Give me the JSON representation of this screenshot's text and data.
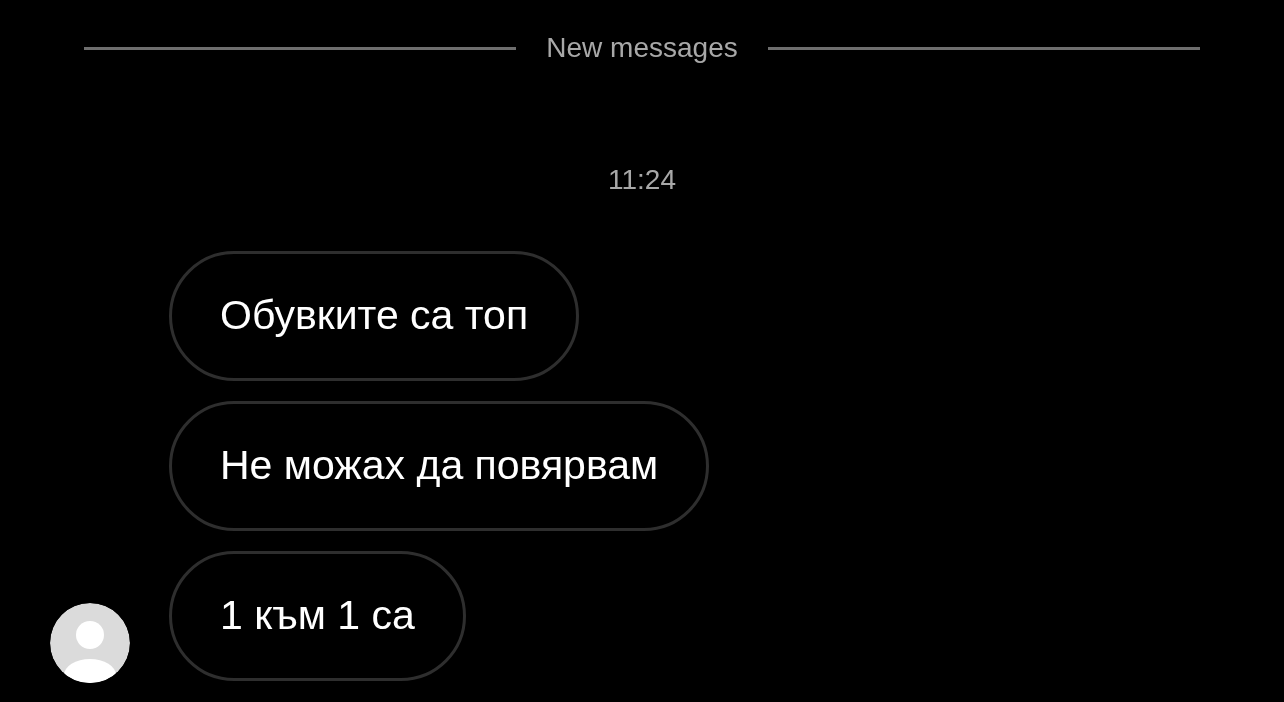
{
  "divider": {
    "label": "New messages"
  },
  "timestamp": "11:24",
  "messages": [
    {
      "text": "Обувките са топ"
    },
    {
      "text": "Не можах да повярвам"
    },
    {
      "text": "1 към 1 са"
    }
  ]
}
